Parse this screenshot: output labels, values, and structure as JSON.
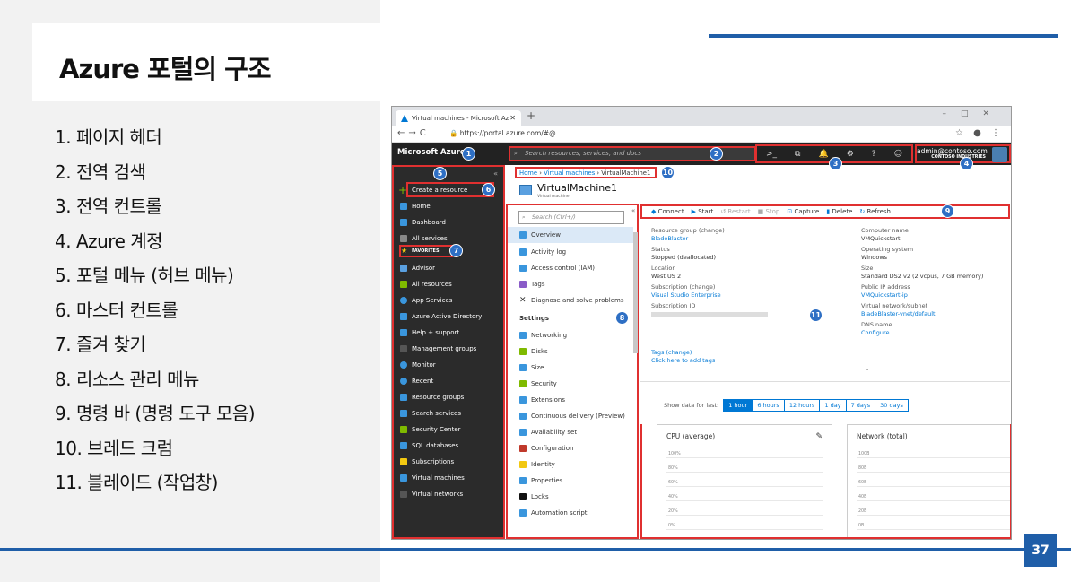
{
  "slide": {
    "title": "Azure 포털의 구조",
    "page_number": "37",
    "items": [
      "1. 페이지 헤더",
      "2. 전역 검색",
      "3. 전역 컨트롤",
      "4. Azure 계정",
      "5. 포털 메뉴 (허브 메뉴)",
      "6. 마스터 컨트롤",
      "7. 즐겨 찾기",
      "8. 리소스 관리 메뉴",
      "9. 명령 바 (명령 도구 모음)",
      "10.  브레드 크럼",
      "11.  블레이드 (작업창)"
    ]
  },
  "browser": {
    "tab_title": "Virtual machines - Microsoft Az",
    "url": "https://portal.azure.com/#@"
  },
  "portal": {
    "brand": "Microsoft Azure",
    "search_placeholder": "Search resources, services, and docs",
    "account_email": "admin@contoso.com",
    "account_org": "CONTOSO INDUSTRIES",
    "global_controls": [
      ">_",
      "⧉",
      "🔔",
      "⚙",
      "?",
      "☺"
    ],
    "create_label": "Create a resource",
    "favorites_label": "FAVORITES",
    "sidebar": [
      "Home",
      "Dashboard",
      "All services",
      "Advisor",
      "All resources",
      "App Services",
      "Azure Active Directory",
      "Help + support",
      "Management groups",
      "Monitor",
      "Recent",
      "Resource groups",
      "Search services",
      "Security Center",
      "SQL databases",
      "Subscriptions",
      "Virtual machines",
      "Virtual networks"
    ],
    "sidebar_colors": [
      "#3a96dd",
      "#3a96dd",
      "#888",
      "#5aa0e0",
      "#7fba00",
      "#3a96dd",
      "#3a96dd",
      "#3a96dd",
      "#555",
      "#3a96dd",
      "#3a96dd",
      "#3a96dd",
      "#3a96dd",
      "#7fba00",
      "#3a96dd",
      "#f2c811",
      "#3a96dd",
      "#555"
    ],
    "breadcrumb": {
      "home": "Home",
      "vms": "Virtual machines",
      "current": "VirtualMachine1"
    },
    "vm_title": "VirtualMachine1",
    "vm_subtitle": "Virtual machine",
    "resmenu_search": "Search (Ctrl+/)",
    "resmenu_items": [
      "Overview",
      "Activity log",
      "Access control (IAM)",
      "Tags",
      "Diagnose and solve problems"
    ],
    "settings_label": "Settings",
    "settings_items": [
      "Networking",
      "Disks",
      "Size",
      "Security",
      "Extensions",
      "Continuous delivery (Preview)",
      "Availability set",
      "Configuration",
      "Identity",
      "Properties",
      "Locks",
      "Automation script"
    ],
    "commands": [
      "Connect",
      "Start",
      "Restart",
      "Stop",
      "Capture",
      "Delete",
      "Refresh"
    ],
    "essentials_left": [
      [
        "Resource group (change)",
        "BladeBlaster"
      ],
      [
        "Status",
        "Stopped (deallocated)"
      ],
      [
        "Location",
        "West US 2"
      ],
      [
        "Subscription (change)",
        "Visual Studio Enterprise"
      ],
      [
        "Subscription ID",
        ""
      ]
    ],
    "essentials_right": [
      [
        "Computer name",
        "VMQuickstart"
      ],
      [
        "Operating system",
        "Windows"
      ],
      [
        "Size",
        "Standard DS2 v2 (2 vcpus, 7 GB memory)"
      ],
      [
        "Public IP address",
        "VMQuickstart-ip"
      ],
      [
        "Virtual network/subnet",
        "BladeBlaster-vnet/default"
      ],
      [
        "DNS name",
        "Configure"
      ]
    ],
    "tags_label": "Tags (change)",
    "tags_link": "Click here to add tags",
    "show_data_label": "Show data for last:",
    "time_ranges": [
      "1 hour",
      "6 hours",
      "12 hours",
      "1 day",
      "7 days",
      "30 days"
    ],
    "cpu_title": "CPU (average)",
    "net_title": "Network (total)",
    "cpu_ticks": [
      "100%",
      "80%",
      "60%",
      "40%",
      "20%",
      "0%"
    ],
    "net_ticks": [
      "100B",
      "80B",
      "60B",
      "40B",
      "20B",
      "0B"
    ]
  },
  "badges": [
    "1",
    "2",
    "3",
    "4",
    "5",
    "6",
    "7",
    "8",
    "9",
    "10",
    "11"
  ]
}
